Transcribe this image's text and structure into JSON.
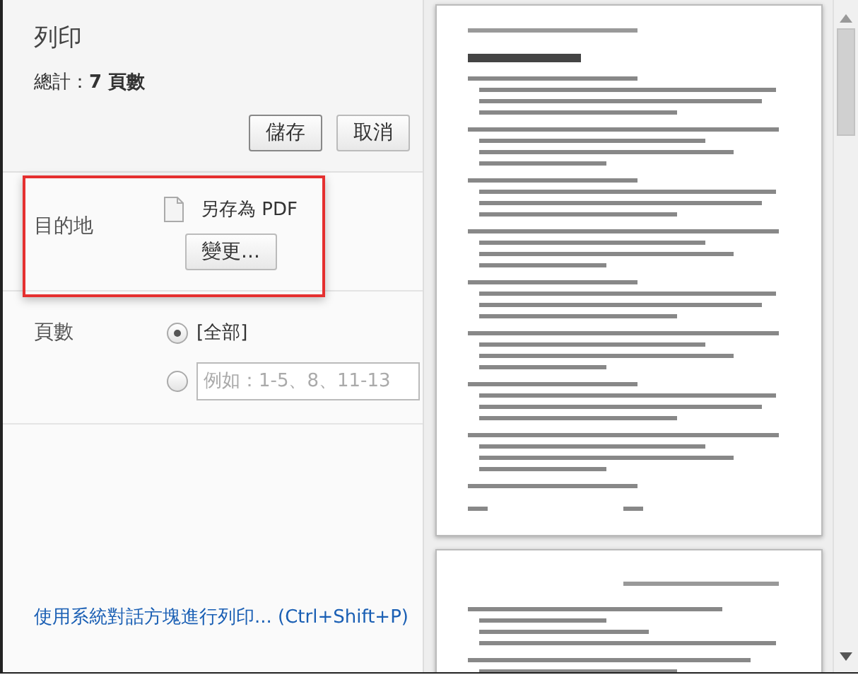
{
  "window": {
    "title": "列印",
    "summary": "總計：**7 頁數**"
  },
  "buttons": [
    {
      "label": "儲存",
      "kind": "primary"
    },
    {
      "label": "取消",
      "kind": "secondary"
    }
  ],
  "destination": {
    "label": "目的地",
    "value": "另存為 PDF",
    "button": "變更..."
  },
  "pages": {
    "label": "頁數",
    "options": [
      {
        "kind": "all",
        "label": "[全部]",
        "selected": true
      },
      {
        "kind": "custom",
        "placeholder": "例如：1-5、8、11-13",
        "selected": false
      }
    ]
  },
  "system_dialog_link": "使用系統對話方塊進行列印... (Ctrl+Shift+P)"
}
